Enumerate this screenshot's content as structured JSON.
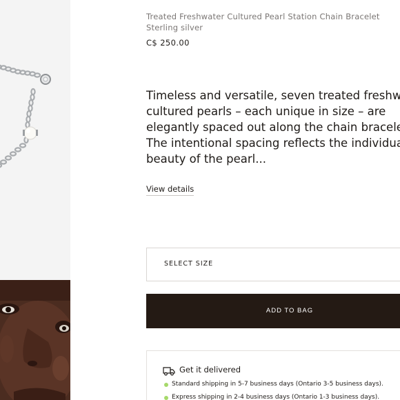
{
  "product": {
    "name": "Treated Freshwater Cultured Pearl Station Chain Bracelet",
    "material": "Sterling silver",
    "price": "C$ 250.00"
  },
  "description": {
    "lines": [
      "Timeless and versatile, seven treated freshwa",
      "cultured pearls – each unique in size – are",
      "elegantly spaced out along the chain bracele",
      "The intentional spacing reflects the individua",
      "beauty of the pearl..."
    ]
  },
  "view_details_label": "View details",
  "select_size_label": "SELECT SIZE",
  "add_to_bag_label": "ADD TO BAG",
  "delivery": {
    "title": "Get it delivered",
    "icon": "truck-icon",
    "status_color": "#a6d96a",
    "options": [
      "Standard shipping in 5-7 business days (Ontario 3-5 business days).",
      "Express shipping in 2-4 business days (Ontario 1-3 business days)."
    ]
  },
  "gallery": {
    "images": [
      {
        "name": "bracelet-product-image"
      },
      {
        "name": "model-photo"
      }
    ]
  },
  "colors": {
    "button_bg": "#241a14",
    "text": "#1e1a17",
    "muted_text": "#7a7674",
    "image_bg": "#f4f4f4"
  }
}
